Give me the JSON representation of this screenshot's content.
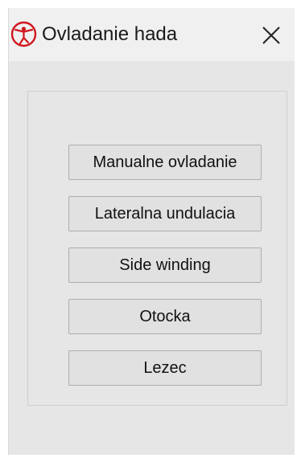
{
  "window": {
    "title": "Ovladanie hada",
    "app_icon": "snake-app-icon",
    "close_icon": "close-icon",
    "accent_color": "#d0181e"
  },
  "panel": {
    "buttons": [
      {
        "label": "Manualne ovladanie"
      },
      {
        "label": "Lateralna undulacia"
      },
      {
        "label": "Side winding"
      },
      {
        "label": "Otocka"
      },
      {
        "label": "Lezec"
      }
    ]
  }
}
